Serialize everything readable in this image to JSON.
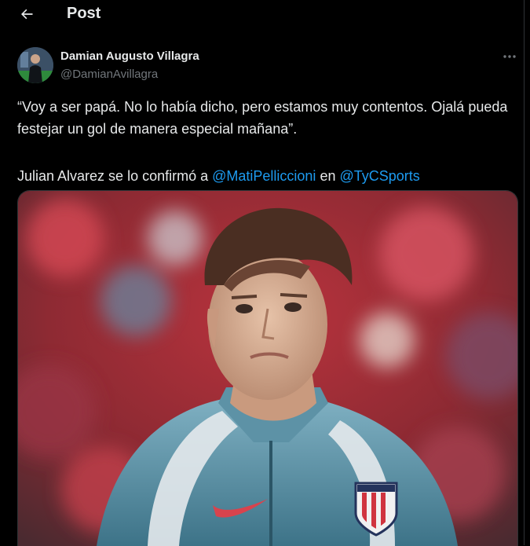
{
  "header": {
    "title": "Post",
    "back_icon": "arrow-left-icon"
  },
  "author": {
    "display_name": "Damian Augusto Villagra",
    "handle": "@DamianAvillagra",
    "more_icon": "more-horizontal-icon"
  },
  "tweet": {
    "quote": "“Voy a ser papá. No lo había dicho, pero estamos muy contentos. Ojalá pueda festejar un gol de manera especial mañana”.",
    "line2_prefix": "Julian Alvarez se lo confirmó a ",
    "mention1": "@MatiPelliccioni",
    "line2_middle": " en ",
    "mention2": "@TyCSports"
  },
  "colors": {
    "background": "#000000",
    "text": "#e7e9ea",
    "secondary_text": "#71767b",
    "link": "#1d9bf0",
    "border": "#2f3336"
  }
}
